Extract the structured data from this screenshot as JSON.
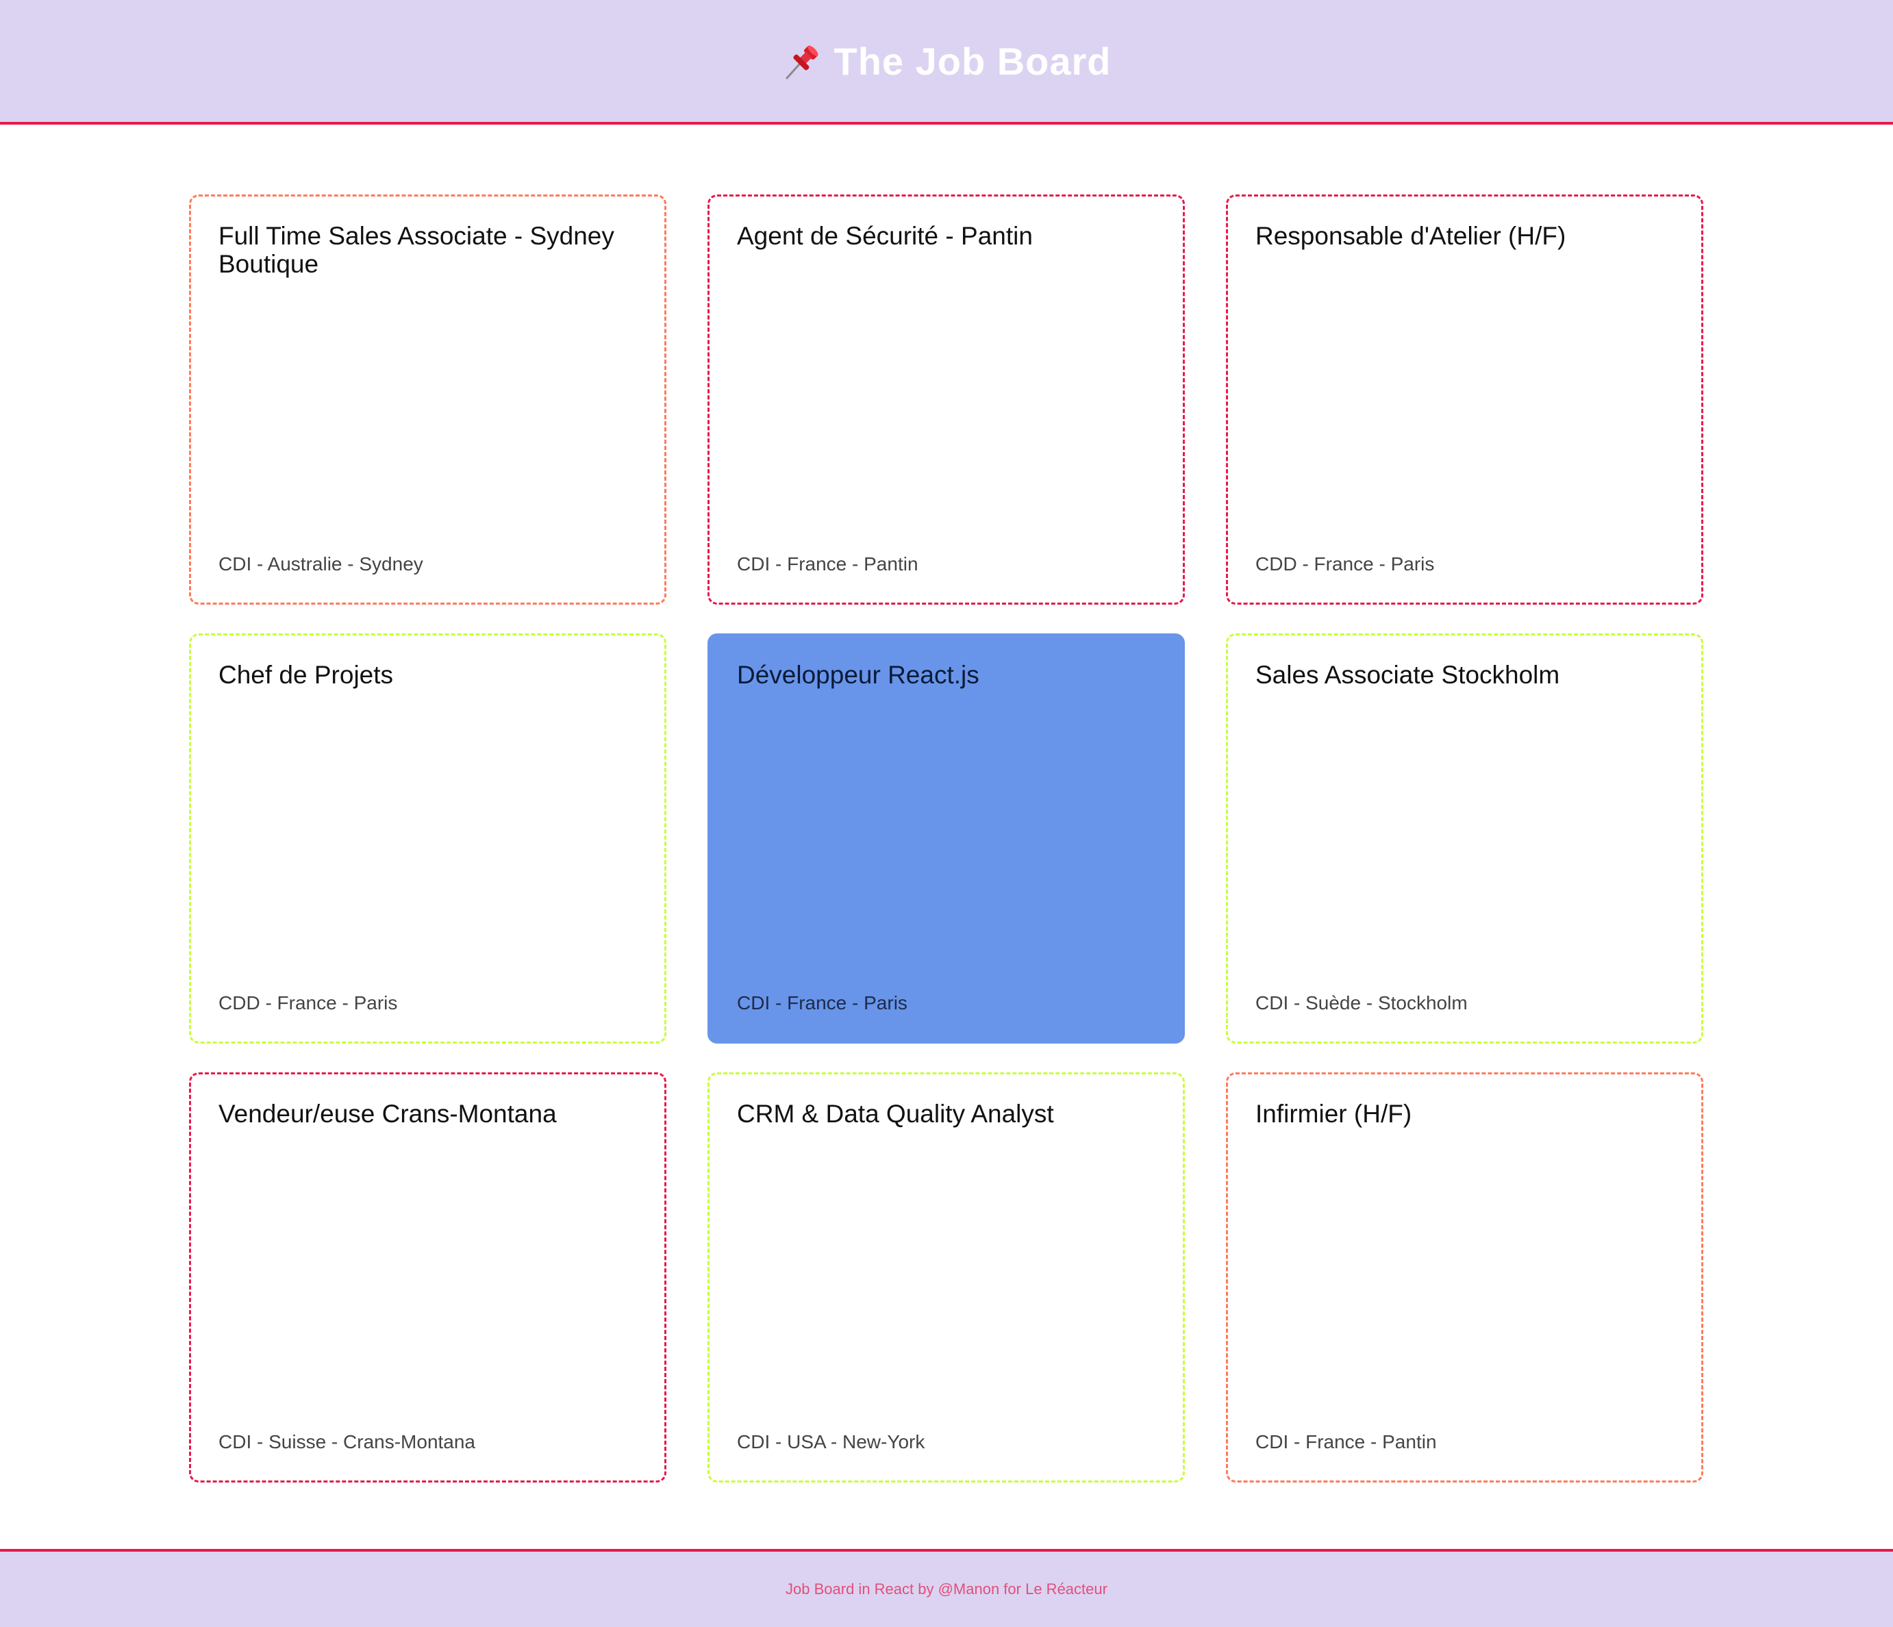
{
  "header": {
    "title": "The Job Board",
    "icon": "pushpin-icon"
  },
  "jobs": [
    {
      "title": "Full Time Sales Associate - Sydney Boutique",
      "meta": "CDI - Australie - Sydney"
    },
    {
      "title": "Agent de Sécurité - Pantin",
      "meta": "CDI - France - Pantin"
    },
    {
      "title": "Responsable d'Atelier (H/F)",
      "meta": "CDD - France - Paris"
    },
    {
      "title": "Chef de Projets",
      "meta": "CDD - France - Paris"
    },
    {
      "title": "Développeur React.js",
      "meta": "CDI - France - Paris"
    },
    {
      "title": "Sales Associate Stockholm",
      "meta": "CDI - Suède - Stockholm"
    },
    {
      "title": "Vendeur/euse Crans-Montana",
      "meta": "CDI - Suisse - Crans-Montana"
    },
    {
      "title": "CRM & Data Quality Analyst",
      "meta": "CDI - USA - New-York"
    },
    {
      "title": "Infirmier (H/F)",
      "meta": "CDI - France - Pantin"
    }
  ],
  "footer": {
    "text": "Job Board in React by @Manon for Le Réacteur"
  },
  "colors": {
    "header_bg": "#dcd3f2",
    "accent_line": "#e6194b",
    "card_border_red": "#e6194b",
    "card_border_orange": "#ff7a59",
    "card_border_lime": "#c6ff3a",
    "card_active_bg": "#6895e9",
    "footer_text": "#e0507a"
  }
}
